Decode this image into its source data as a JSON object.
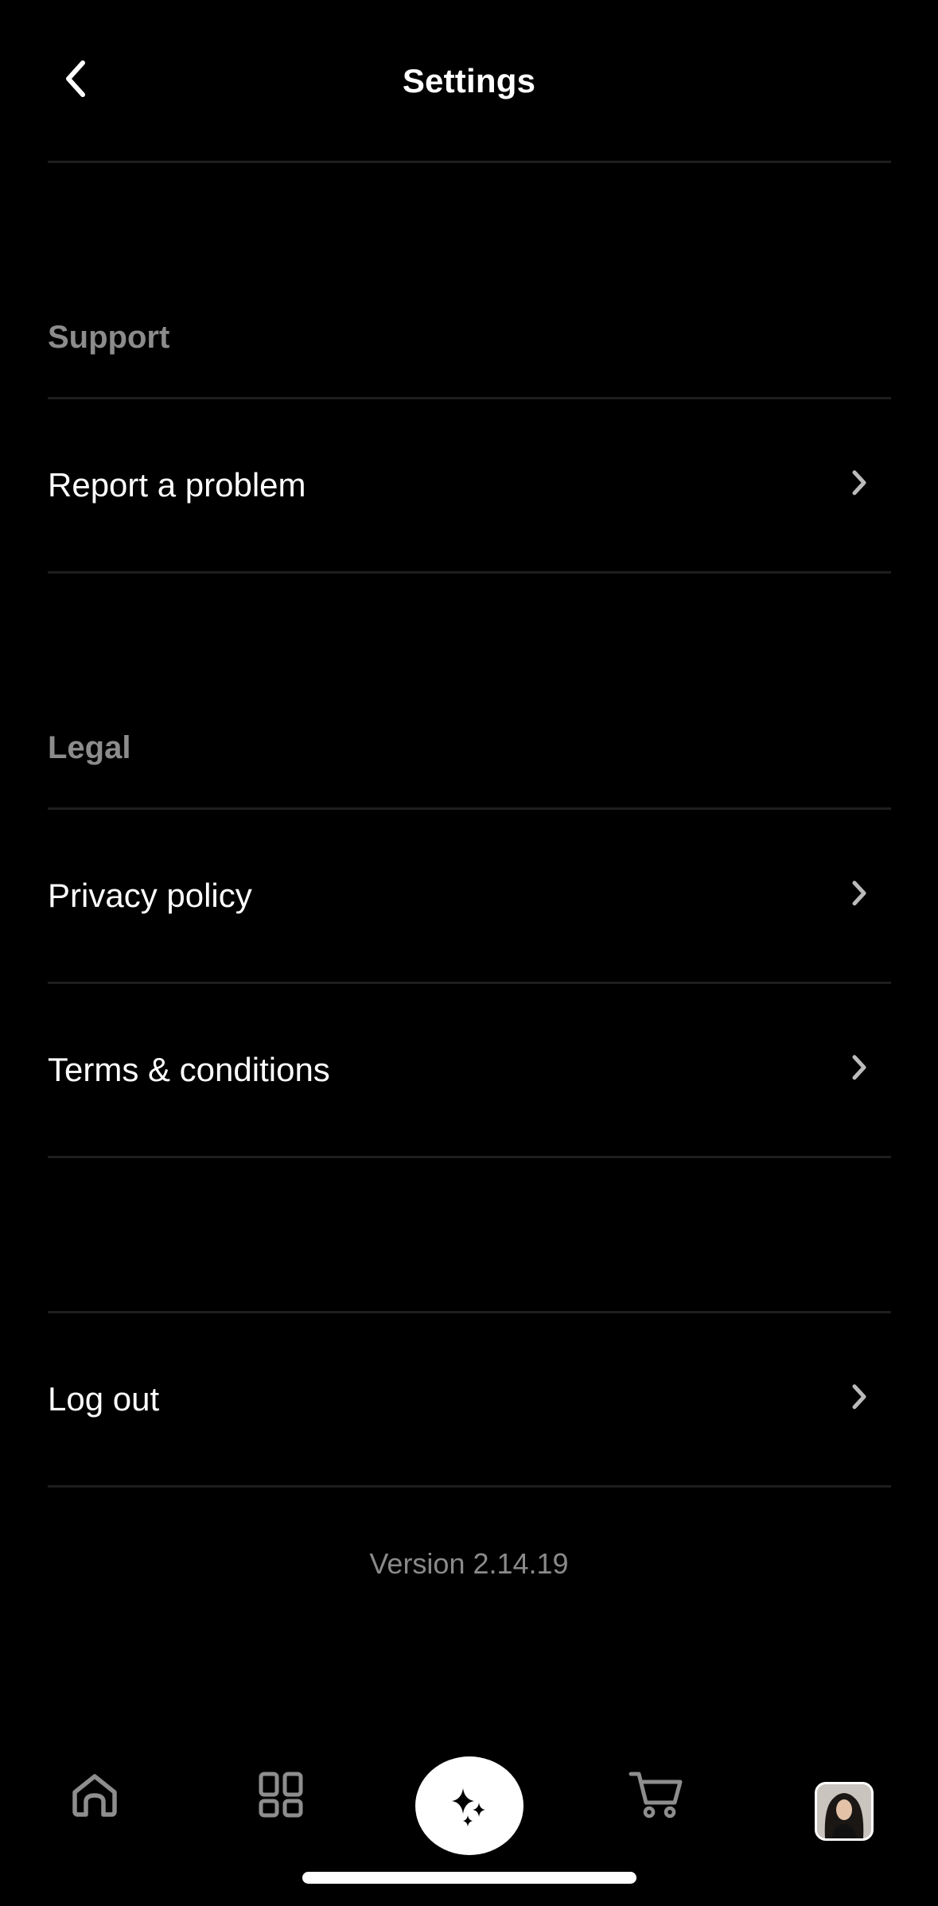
{
  "header": {
    "title": "Settings"
  },
  "sections": {
    "support": {
      "label": "Support",
      "items": [
        {
          "label": "Report a problem"
        }
      ]
    },
    "legal": {
      "label": "Legal",
      "items": [
        {
          "label": "Privacy policy"
        },
        {
          "label": "Terms & conditions"
        }
      ]
    },
    "account": {
      "items": [
        {
          "label": "Log out"
        }
      ]
    }
  },
  "version": "Version 2.14.19",
  "bottom_nav": {
    "items": [
      {
        "icon": "home-icon"
      },
      {
        "icon": "grid-icon"
      },
      {
        "icon": "sparkle-icon",
        "active": true
      },
      {
        "icon": "cart-icon"
      },
      {
        "icon": "avatar"
      }
    ]
  },
  "colors": {
    "background": "#000000",
    "text": "#ffffff",
    "muted": "#8c8c8c",
    "divider": "#1e1e1e"
  }
}
